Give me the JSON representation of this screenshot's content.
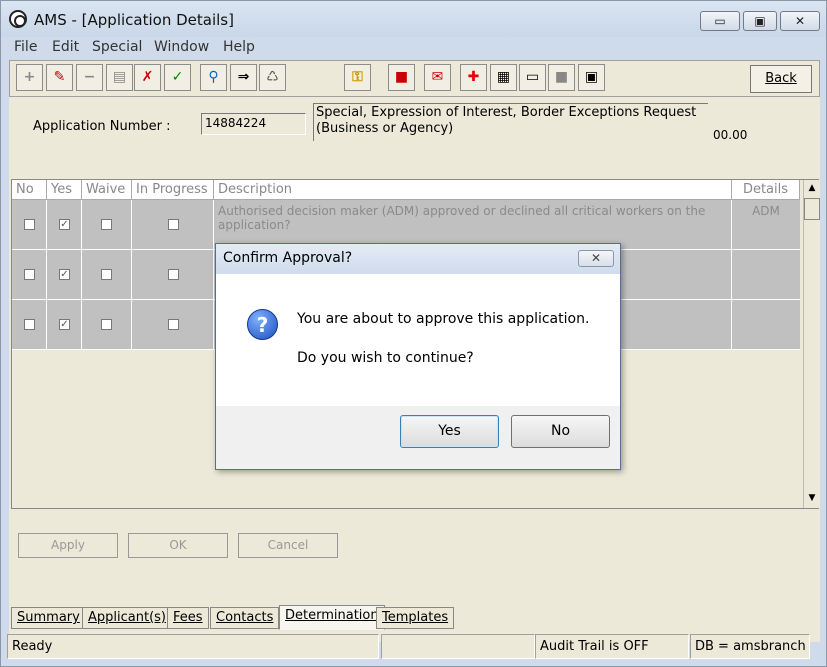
{
  "window": {
    "title": "AMS - [Application Details]",
    "minimize": "▭",
    "maximize": "▣",
    "close": "✕"
  },
  "menu": [
    "File",
    "Edit",
    "Special",
    "Window",
    "Help"
  ],
  "toolbar": {
    "back_label": "Back",
    "icons": [
      "add-icon",
      "edit-icon",
      "remove-icon",
      "print-icon",
      "reject-check-icon",
      "approve-check-icon",
      "search-person-icon",
      "assign-icon",
      "recycle-icon",
      "key-icon",
      "stop-hand-icon",
      "inbox-icon",
      "red-cross-icon",
      "document-icon",
      "card-icon",
      "square-icon",
      "page-icon"
    ]
  },
  "application": {
    "number_label": "Application Number :",
    "number": "14884224",
    "description": "Special, Expression of Interest, Border Exceptions Request (Business or Agency)",
    "amount": "00.00"
  },
  "grid": {
    "headers": [
      "No",
      "Yes",
      "Waive",
      "In Progress",
      "Description",
      "Details"
    ],
    "rows": [
      {
        "no": false,
        "yes": true,
        "waive": false,
        "in_progress": false,
        "description": "Authorised decision maker (ADM) approved or declined all critical workers on the application?",
        "details": "ADM"
      },
      {
        "no": false,
        "yes": true,
        "waive": false,
        "in_progress": false,
        "description": "",
        "details": ""
      },
      {
        "no": false,
        "yes": true,
        "waive": false,
        "in_progress": false,
        "description": "",
        "details": ""
      }
    ]
  },
  "actions": {
    "apply": "Apply",
    "ok": "OK",
    "cancel": "Cancel"
  },
  "tabs": [
    "Summary",
    "Applicant(s)",
    "Fees",
    "Contacts",
    "Determination",
    "Templates"
  ],
  "active_tab": "Determination",
  "status": {
    "ready": "Ready",
    "blank": "",
    "audit": "Audit Trail is OFF",
    "db": "DB = amsbranch"
  },
  "dialog": {
    "title": "Confirm Approval?",
    "close": "✕",
    "icon": "question-icon",
    "message1": "You are about to approve this application.",
    "message2": "Do you wish to continue?",
    "yes": "Yes",
    "no": "No"
  }
}
